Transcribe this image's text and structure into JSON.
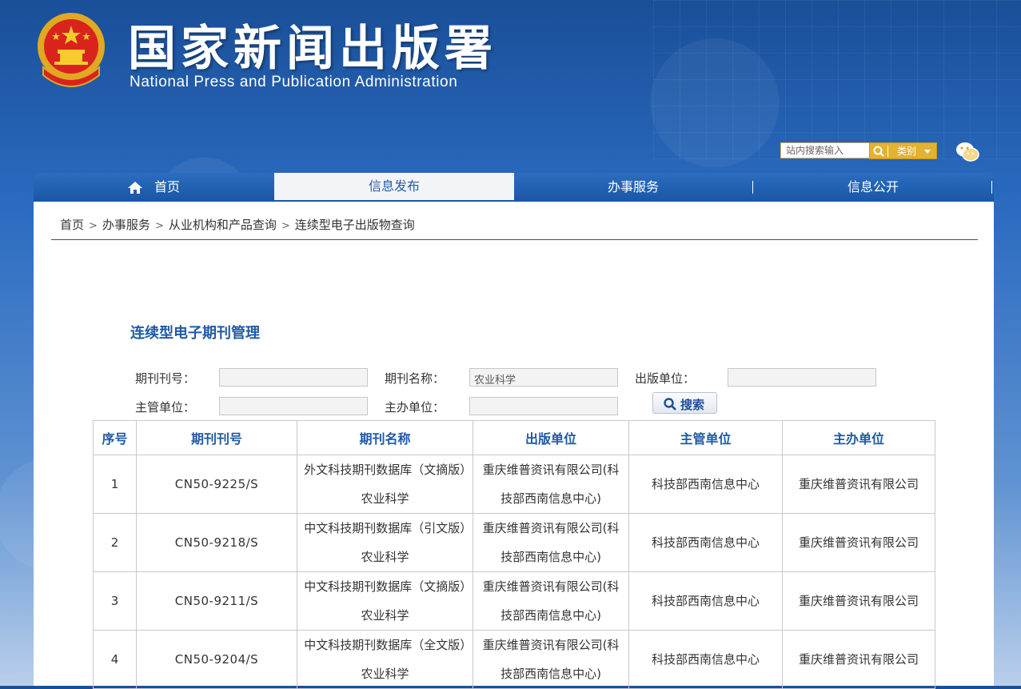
{
  "header": {
    "title_cn": "国家新闻出版署",
    "title_en": "National  Press and Publication Administration",
    "search_placeholder": "站内搜索输入",
    "category_label": "类别"
  },
  "nav": {
    "items": [
      {
        "label": "首页"
      },
      {
        "label": "信息发布"
      },
      {
        "label": "办事服务"
      },
      {
        "label": "信息公开"
      }
    ],
    "active_index": 1
  },
  "breadcrumb": {
    "items": [
      "首页",
      "办事服务",
      "从业机构和产品查询",
      "连续型电子出版物查询"
    ],
    "separator": ">"
  },
  "page": {
    "title": "连续型电子期刊管理"
  },
  "form": {
    "issn_label": "期刊刊号：",
    "issn_value": "",
    "name_label": "期刊名称：",
    "name_value": "农业科学",
    "publisher_label": "出版单位：",
    "publisher_value": "",
    "supervisor_label": "主管单位：",
    "supervisor_value": "",
    "sponsor_label": "主办单位：",
    "sponsor_value": "",
    "search_button": "搜索"
  },
  "table": {
    "headers": [
      "序号",
      "期刊刊号",
      "期刊名称",
      "出版单位",
      "主管单位",
      "主办单位"
    ],
    "rows": [
      [
        "1",
        "CN50-9225/S",
        "外文科技期刊数据库（文摘版）农业科学",
        "重庆维普资讯有限公司(科技部西南信息中心)",
        "科技部西南信息中心",
        "重庆维普资讯有限公司"
      ],
      [
        "2",
        "CN50-9218/S",
        "中文科技期刊数据库（引文版）农业科学",
        "重庆维普资讯有限公司(科技部西南信息中心)",
        "科技部西南信息中心",
        "重庆维普资讯有限公司"
      ],
      [
        "3",
        "CN50-9211/S",
        "中文科技期刊数据库（文摘版）农业科学",
        "重庆维普资讯有限公司(科技部西南信息中心)",
        "科技部西南信息中心",
        "重庆维普资讯有限公司"
      ],
      [
        "4",
        "CN50-9204/S",
        "中文科技期刊数据库（全文版）农业科学",
        "重庆维普资讯有限公司(科技部西南信息中心)",
        "科技部西南信息中心",
        "重庆维普资讯有限公司"
      ]
    ]
  },
  "colors": {
    "header_bg": "#1a4f98",
    "nav_bg": "#1a56a6",
    "accent_blue": "#1f5aa6",
    "search_gold": "#e3b232"
  },
  "icons": [
    "national-emblem-icon",
    "search-icon",
    "chevron-down-icon",
    "wechat-icon",
    "home-icon"
  ]
}
